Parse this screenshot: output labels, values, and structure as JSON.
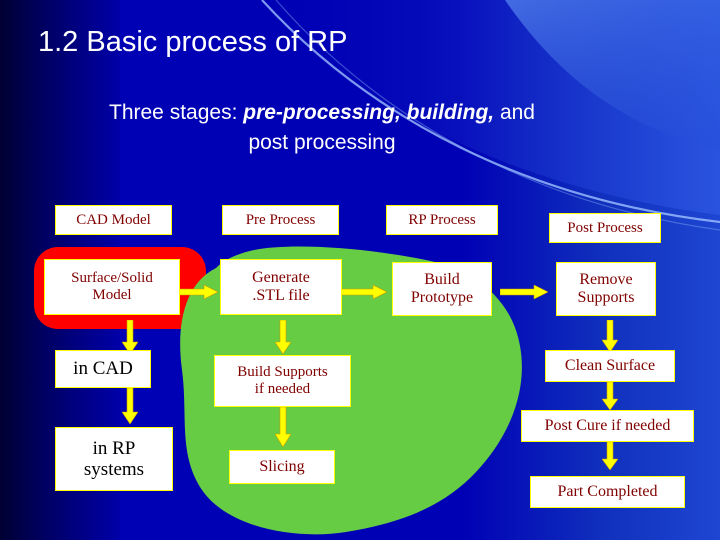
{
  "slide": {
    "title": "1.2 Basic process of RP",
    "subtitle": {
      "lead": "Three stages:",
      "emphasis": "pre-processing, building,",
      "trail": "and",
      "line2": "post processing"
    },
    "colors": {
      "background": "#0000b4",
      "accent_red": "#ff0000",
      "accent_green": "#66cc44",
      "box_border": "#ffff00",
      "box_fill": "#ffffff",
      "text_maroon": "#800000",
      "title_text": "#ffffff"
    },
    "columns": [
      {
        "header": "CAD Model",
        "boxes": [
          "Surface/Solid\nModel",
          "in CAD",
          "in RP\nsystems"
        ]
      },
      {
        "header": "Pre Process",
        "boxes": [
          "Generate\n.STL file",
          "Build Supports\nif needed",
          "Slicing"
        ]
      },
      {
        "header": "RP Process",
        "boxes": [
          "Build\nPrototype"
        ]
      },
      {
        "header": "Post Process",
        "boxes": [
          "Remove\nSupports",
          "Clean Surface",
          "Post Cure if needed",
          "Part Completed"
        ]
      }
    ],
    "labels": {
      "cad_model": "CAD Model",
      "pre_process": "Pre Process",
      "rp_process": "RP Process",
      "post_process": "Post Process",
      "surface_solid_model_1": "Surface/Solid",
      "surface_solid_model_2": "Model",
      "in_cad": "in CAD",
      "in_rp_1": "in RP",
      "in_rp_2": "systems",
      "generate_1": "Generate",
      "generate_2": ".STL file",
      "build_supports_1": "Build Supports",
      "build_supports_2": "if needed",
      "slicing": "Slicing",
      "build_1": "Build",
      "build_2": "Prototype",
      "remove_1": "Remove",
      "remove_2": "Supports",
      "clean_surface": "Clean Surface",
      "post_cure": "Post Cure if needed",
      "part_completed": "Part Completed"
    }
  }
}
